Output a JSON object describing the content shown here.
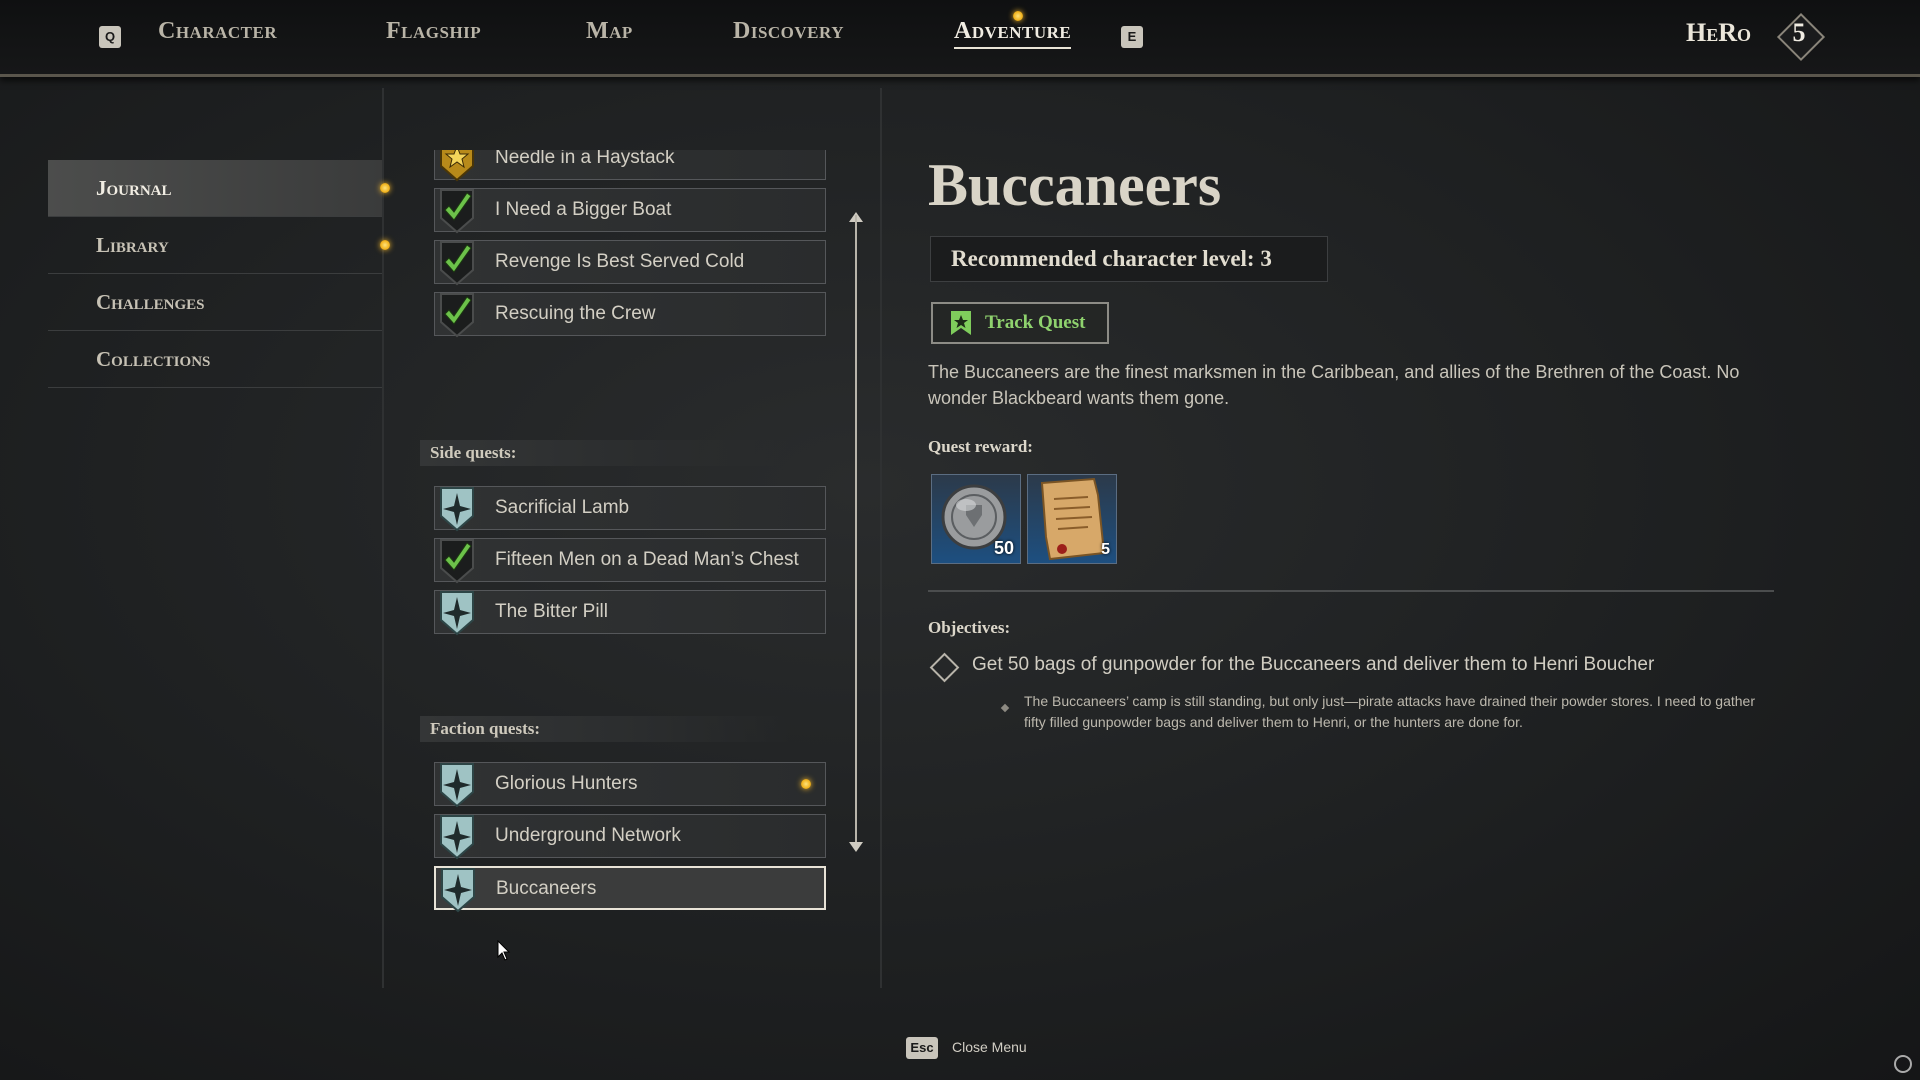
{
  "topbar": {
    "left_key": "Q",
    "right_key": "E",
    "tabs": [
      {
        "label": "Character"
      },
      {
        "label": "Flagship"
      },
      {
        "label": "Map"
      },
      {
        "label": "Discovery"
      },
      {
        "label": "Adventure",
        "active": true,
        "notification": true
      }
    ],
    "player_name": "HeRo",
    "player_level": "5"
  },
  "sidebar": {
    "items": [
      {
        "label": "Journal",
        "active": true,
        "notification": true
      },
      {
        "label": "Library",
        "notification": true
      },
      {
        "label": "Challenges"
      },
      {
        "label": "Collections"
      }
    ]
  },
  "quest_list": {
    "main_quests": [
      {
        "label": "Needle in a Haystack",
        "icon": "gold-star-shield-icon"
      },
      {
        "label": "I Need a Bigger Boat",
        "icon": "checkmark-icon"
      },
      {
        "label": "Revenge Is Best Served Cold",
        "icon": "checkmark-icon"
      },
      {
        "label": "Rescuing the Crew",
        "icon": "checkmark-icon"
      }
    ],
    "side_heading": "Side quests:",
    "side_quests": [
      {
        "label": "Sacrificial Lamb",
        "icon": "compass-star-shield-icon"
      },
      {
        "label": "Fifteen Men on a Dead Man’s Chest",
        "icon": "checkmark-icon"
      },
      {
        "label": "The Bitter Pill",
        "icon": "compass-star-shield-icon"
      }
    ],
    "faction_heading": "Faction quests:",
    "faction_quests": [
      {
        "label": "Glorious Hunters",
        "icon": "compass-star-shield-icon",
        "notification": true
      },
      {
        "label": "Underground Network",
        "icon": "compass-star-shield-icon"
      },
      {
        "label": "Buccaneers",
        "icon": "compass-star-shield-icon",
        "selected": true
      }
    ]
  },
  "details": {
    "title": "Buccaneers",
    "recommended_level": "Recommended character level: 3",
    "track_label": "Track Quest",
    "description": "The Buccaneers are the finest marksmen in the Caribbean, and allies of the Brethren of the Coast. No wonder Blackbeard wants them gone.",
    "reward_heading": "Quest reward:",
    "rewards": [
      {
        "icon": "silver-coin-icon",
        "count": "50"
      },
      {
        "icon": "parchment-scroll-icon",
        "count": "5"
      }
    ],
    "objectives_heading": "Objectives:",
    "objective": "Get 50 bags of gunpowder for the Buccaneers and deliver them to Henri Boucher",
    "objective_detail": "The Buccaneers’ camp is still standing, but only just—pirate attacks have drained their powder stores. I need to gather fifty filled gunpowder bags and deliver them to Henri, or the hunters are done for."
  },
  "footer": {
    "key": "Esc",
    "label": "Close Menu"
  },
  "colors": {
    "accent_gold": "#f0b21d",
    "track_green": "#8fd26e",
    "check_green": "#6cc24a",
    "quest_icon_teal": "#9fc3c4"
  }
}
